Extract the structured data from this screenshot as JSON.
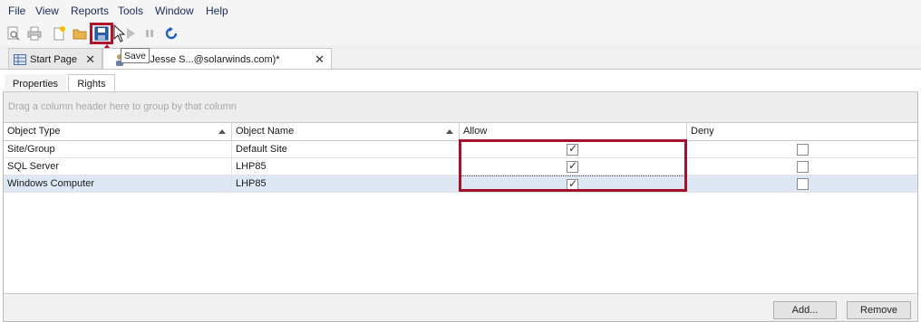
{
  "menu": [
    "File",
    "View",
    "Reports",
    "Tools",
    "Window",
    "Help"
  ],
  "toolbar": {
    "icons": [
      "print-preview-icon",
      "print-icon",
      "new-icon",
      "open-folder-icon",
      "save-icon",
      "run-icon",
      "pause-icon",
      "refresh-icon"
    ],
    "tooltip": "Save"
  },
  "doc_tabs": [
    {
      "label": "Start Page"
    },
    {
      "label": "User: Jesse S...@solarwinds.com)*"
    }
  ],
  "sub_tabs": [
    "Properties",
    "Rights"
  ],
  "grid": {
    "group_hint": "Drag a column header here to group by that column",
    "columns": [
      "Object Type",
      "Object Name",
      "Allow",
      "Deny"
    ],
    "rows": [
      {
        "type": "Site/Group",
        "name": "Default Site",
        "allow": true,
        "deny": false
      },
      {
        "type": "SQL Server",
        "name": "LHP85",
        "allow": true,
        "deny": false
      },
      {
        "type": "Windows Computer",
        "name": "LHP85",
        "allow": true,
        "deny": false
      }
    ]
  },
  "buttons": {
    "add": "Add...",
    "remove": "Remove"
  },
  "colors": {
    "highlight": "#b0112c",
    "selected_row": "#dde8f4"
  }
}
